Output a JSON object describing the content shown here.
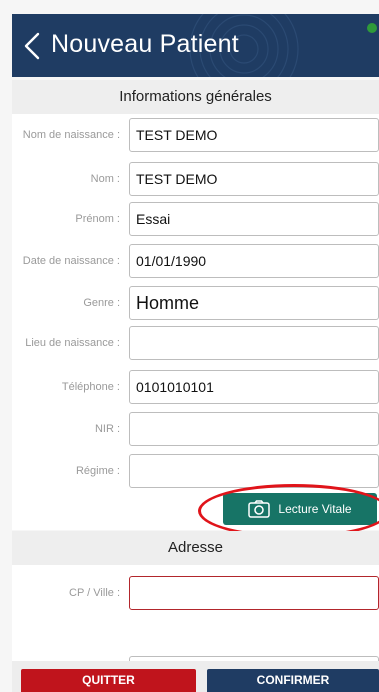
{
  "header": {
    "title": "Nouveau Patient",
    "back_icon": "chevron-left-icon",
    "status_color": "#2f9a3a"
  },
  "sections": {
    "general": "Informations générales",
    "address": "Adresse"
  },
  "fields": {
    "nom_naissance": {
      "label": "Nom de naissance :",
      "value": "TEST DEMO"
    },
    "nom": {
      "label": "Nom :",
      "value": "TEST DEMO"
    },
    "prenom": {
      "label": "Prénom :",
      "value": "Essai"
    },
    "date_naissance": {
      "label": "Date de naissance :",
      "value": "01/01/1990"
    },
    "genre": {
      "label": "Genre :",
      "value": "Homme"
    },
    "lieu_naissance": {
      "label": "Lieu de naissance :",
      "value": ""
    },
    "telephone": {
      "label": "Téléphone :",
      "value": "0101010101"
    },
    "nir": {
      "label": "NIR :",
      "value": ""
    },
    "regime": {
      "label": "Régime :",
      "value": ""
    },
    "cp_ville": {
      "label": "CP / Ville :",
      "value": ""
    }
  },
  "buttons": {
    "lecture_vitale": "Lecture Vitale",
    "quitter": "QUITTER",
    "confirmer": "CONFIRMER"
  },
  "colors": {
    "header_bg": "#1f3c63",
    "vitale_btn": "#177466",
    "quit_btn": "#c0141c",
    "highlight": "#e0141a",
    "error_border": "#b2262c"
  }
}
